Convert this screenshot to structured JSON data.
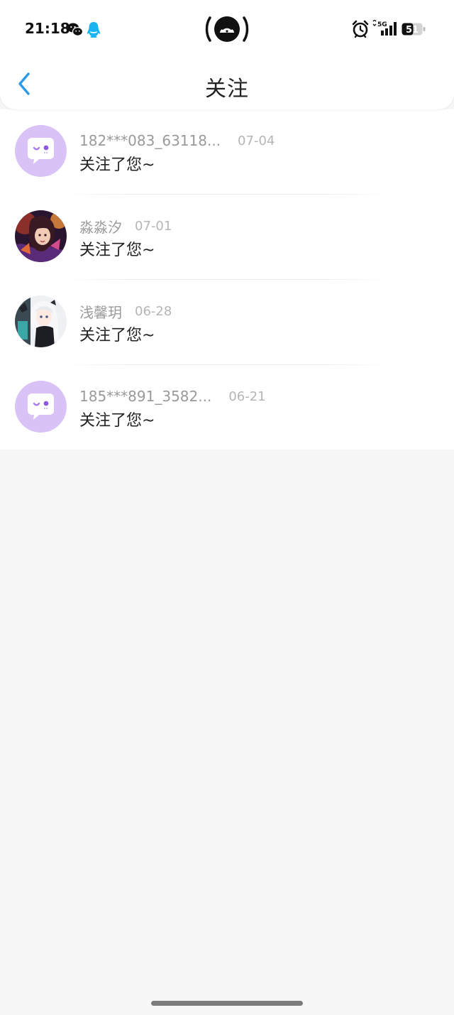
{
  "status_bar": {
    "time": "21:18",
    "left_icons": [
      "wechat-icon",
      "qq-icon"
    ],
    "center_icon": "hotspot-icon",
    "right_icons": [
      "alarm-icon",
      "signal-5g-icon",
      "battery-icon"
    ],
    "network": "5G",
    "battery_level": "51"
  },
  "nav": {
    "back_icon": "chevron-left-icon",
    "title": "关注",
    "accent_color": "#2a9be8"
  },
  "notifications": [
    {
      "user": "182***083_63118...",
      "date": "07-04",
      "message": "关注了您~",
      "avatar": "default-chat-avatar",
      "avatar_color": "#d9bff5"
    },
    {
      "user": "淼淼汐",
      "date": "07-01",
      "message": "关注了您~",
      "avatar": "photo-avatar",
      "avatar_color": "#6a2a5a"
    },
    {
      "user": "浅馨玥",
      "date": "06-28",
      "message": "关注了您~",
      "avatar": "photo-avatar",
      "avatar_color": "#e8e8ee"
    },
    {
      "user": "185***891_3582...",
      "date": "06-21",
      "message": "关注了您~",
      "avatar": "default-chat-avatar",
      "avatar_color": "#d9bff5"
    }
  ]
}
